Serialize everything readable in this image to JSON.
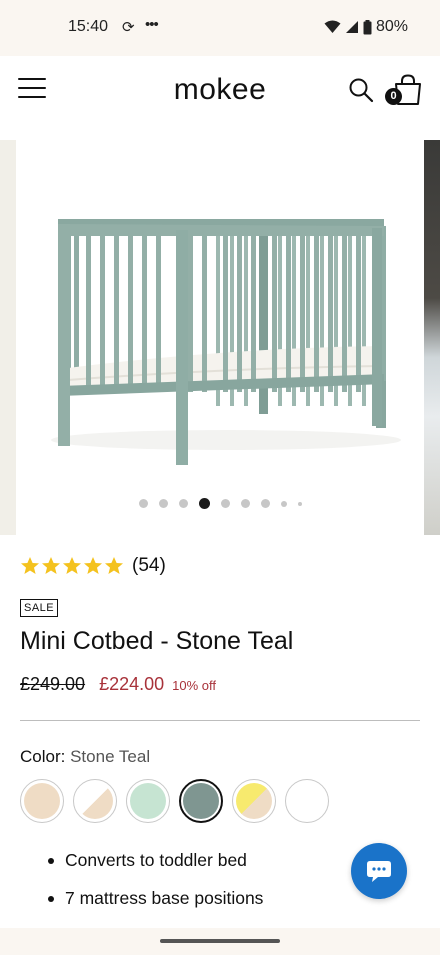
{
  "status_bar": {
    "time": "15:40",
    "sync_glyph": "⟳",
    "dots_glyph": "•••",
    "battery": "80%",
    "icons": [
      "sync-icon",
      "more-icon",
      "wifi-icon",
      "signal-icon",
      "battery-icon"
    ]
  },
  "header": {
    "logo": "mokee",
    "cart_count": "0",
    "icons": [
      "menu-icon",
      "search-icon",
      "bag-icon"
    ]
  },
  "gallery": {
    "image": "mini-cotbed-stone-teal-photo",
    "slide_count": 9,
    "active_slide": 4
  },
  "product": {
    "rating_stars": 5,
    "review_count": "(54)",
    "badge": "SALE",
    "title": "Mini Cotbed - Stone Teal",
    "old_price": "£249.00",
    "price": "£224.00",
    "discount": "10% off",
    "color_label": "Color:",
    "color_value": "Stone Teal",
    "swatches": [
      {
        "name": "beige",
        "colors": [
          "#efdcc5"
        ]
      },
      {
        "name": "white-beige",
        "colors": [
          "#ffffff",
          "#efdcc5"
        ]
      },
      {
        "name": "sage-green",
        "colors": [
          "#c6e4d2"
        ]
      },
      {
        "name": "stone-teal",
        "colors": [
          "#7f9691"
        ],
        "selected": true
      },
      {
        "name": "yellow-beige",
        "colors": [
          "#f7ea6e",
          "#efdcc5"
        ]
      },
      {
        "name": "white",
        "colors": [
          "#ffffff"
        ]
      }
    ],
    "features": [
      "Converts to toddler bed",
      "7 mattress base positions"
    ]
  },
  "colors": {
    "star": "#f4c21e",
    "sale_red": "#a8323a",
    "chat_blue": "#1a73c9",
    "crib_teal": "#93afa7"
  }
}
